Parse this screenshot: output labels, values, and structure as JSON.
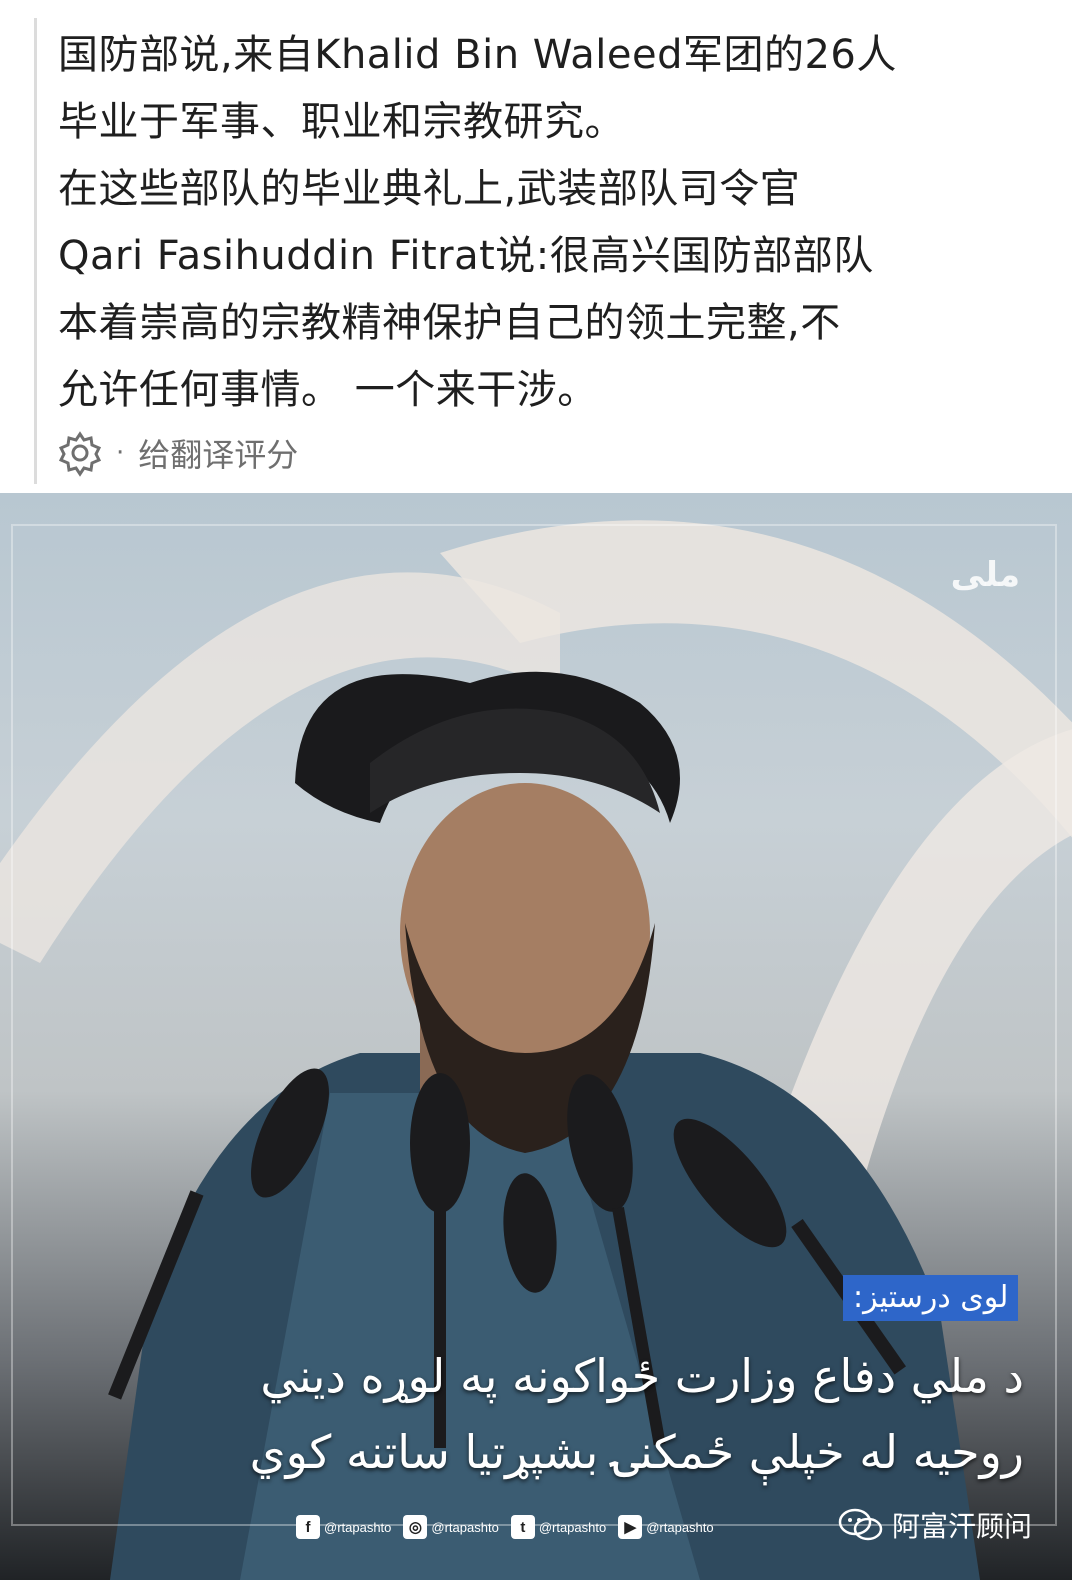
{
  "post": {
    "lines": [
      "国防部说,来自Khalid Bin Waleed军团的26人",
      "毕业于军事、职业和宗教研究。",
      "在这些部队的毕业典礼上,武装部队司令官",
      "Qari Fasihuddin Fitrat说:很高兴国防部部队",
      "本着崇高的宗教精神保护自己的领土完整,不",
      "允许任何事情。 一个来干涉。"
    ],
    "rate_label": "给翻译评分",
    "rate_dot": "·",
    "gear_icon": "gear-icon"
  },
  "image": {
    "logo": "ملی",
    "tag": "لوی درستیز:",
    "caption_lines": [
      "د ملي دفاع وزارت ځواکونه په لوړه ديني",
      "روحيه له خپلې ځمکنۍ بشپړتيا ساتنه کوي"
    ],
    "socials": [
      {
        "icon": "facebook-icon",
        "glyph": "f",
        "handle": "@rtapashto"
      },
      {
        "icon": "instagram-icon",
        "glyph": "◎",
        "handle": "@rtapashto"
      },
      {
        "icon": "twitter-icon",
        "glyph": "t",
        "handle": "@rtapashto"
      },
      {
        "icon": "youtube-icon",
        "glyph": "▶",
        "handle": "@rtapashto"
      }
    ],
    "watermark": "阿富汗顾问",
    "watermark_icon": "wechat-icon"
  },
  "colors": {
    "tag_bg": "#2e66c9",
    "text": "#1f1f1f",
    "muted": "#6f6f6f"
  }
}
